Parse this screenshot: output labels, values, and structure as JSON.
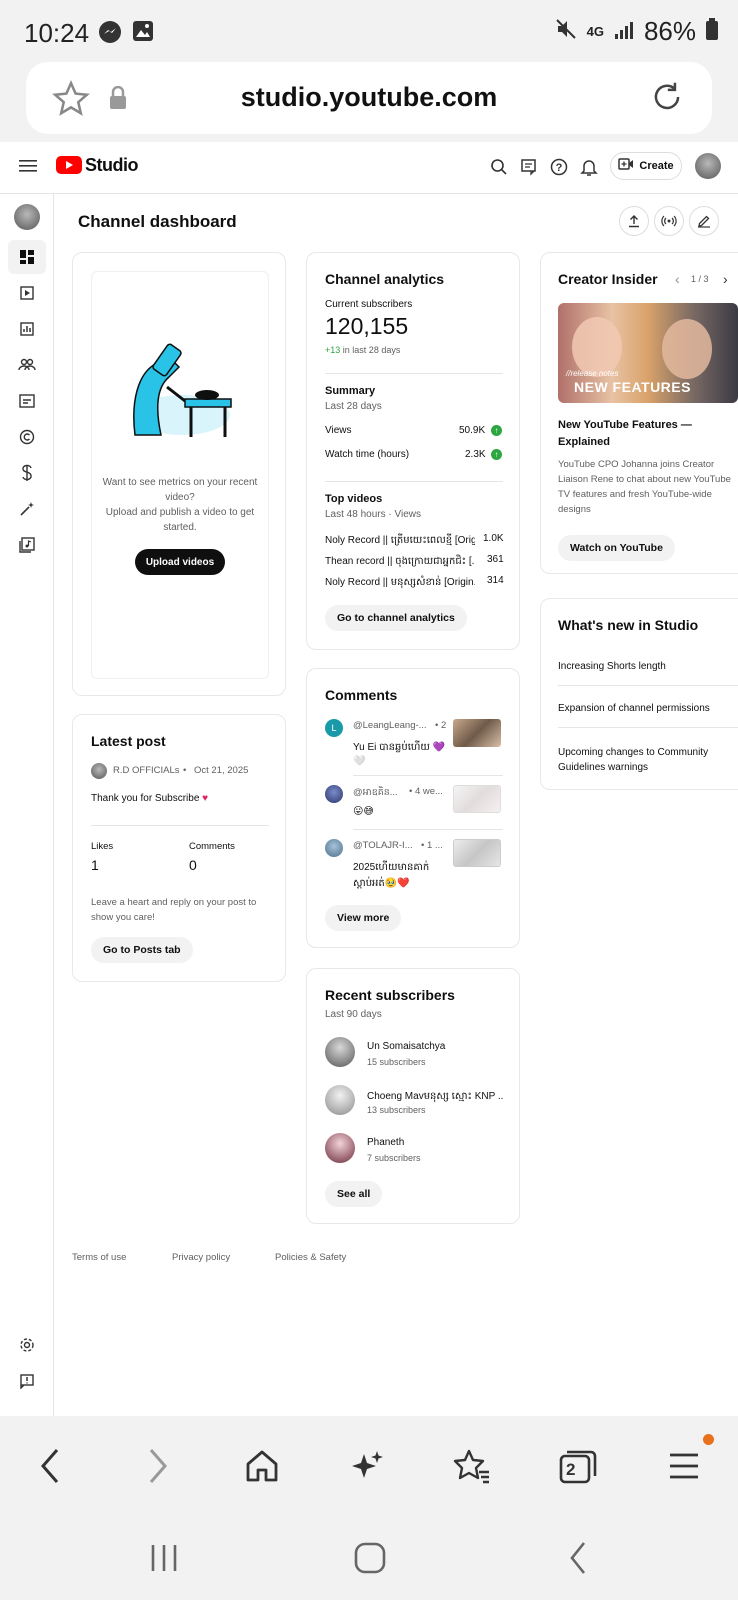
{
  "status": {
    "time": "10:24",
    "network": "4G",
    "battery": "86%"
  },
  "browser": {
    "url": "studio.youtube.com",
    "tab_count": "2"
  },
  "header": {
    "logo": "Studio",
    "create_label": "Create"
  },
  "page": {
    "title": "Channel dashboard"
  },
  "upload_card": {
    "message_1": "Want to see metrics on your recent video?",
    "message_2": "Upload and publish a video to get started.",
    "button": "Upload videos"
  },
  "latest_post": {
    "title": "Latest post",
    "author": "R.D OFFICIALs",
    "date": "Oct 21, 2025",
    "text": "Thank you for Subscribe",
    "likes_label": "Likes",
    "likes_value": "1",
    "comments_label": "Comments",
    "comments_value": "0",
    "hint": "Leave a heart and reply on your post to show you care!",
    "button": "Go to Posts tab"
  },
  "analytics": {
    "title": "Channel analytics",
    "subs_label": "Current subscribers",
    "subs_value": "120,155",
    "subs_change": "+13",
    "subs_change_suffix": "in last 28 days",
    "summary_title": "Summary",
    "summary_period": "Last 28 days",
    "views_label": "Views",
    "views_value": "50.9K",
    "watch_label": "Watch time (hours)",
    "watch_value": "2.3K",
    "top_title": "Top videos",
    "top_period": "Last 48 hours · Views",
    "top_videos": [
      {
        "title": "Noly Record || ត្រើមយេះពេលខ្មី [Origi...",
        "views": "1.0K"
      },
      {
        "title": "Thean record || ចុងក្រោយជាអ្នកជិះ [...",
        "views": "361"
      },
      {
        "title": "Noly Record || មនុស្សសំខាន់ [Origin...",
        "views": "314"
      }
    ],
    "button": "Go to channel analytics"
  },
  "comments": {
    "title": "Comments",
    "items": [
      {
        "author": "@LeangLeang-...",
        "time": "• 2",
        "text": "Yu Ei បានឆ្លប់ហើយ 💜",
        "text2": "🤍",
        "initial": "L"
      },
      {
        "author": "@អាឧគិន...",
        "time": "• 4 we...",
        "text": "😛😅",
        "text2": "",
        "initial": ""
      },
      {
        "author": "@TOLAJR-I...",
        "time": "• 1 ...",
        "text": "2025ហើយមានគាក់",
        "text2": "ស្តាប់អត់🥹❤️",
        "initial": ""
      }
    ],
    "button": "View more"
  },
  "subscribers": {
    "title": "Recent subscribers",
    "period": "Last 90 days",
    "items": [
      {
        "name": "Un Somaisatchya",
        "count": "15 subscribers"
      },
      {
        "name": "Choeng Mavមនុស្ស ស្មោះ KNP ...",
        "count": "13 subscribers"
      },
      {
        "name": "Phaneth",
        "count": "7 subscribers"
      }
    ],
    "button": "See all"
  },
  "creator_insider": {
    "title": "Creator Insider",
    "pager": "1 / 3",
    "thumb_tag": "//release notes",
    "thumb_text": "NEW FEATURES",
    "video_title": "New YouTube Features — Explained",
    "description": "YouTube CPO Johanna joins Creator Liaison Rene to chat about new YouTube TV features and fresh YouTube-wide designs",
    "button": "Watch on YouTube"
  },
  "whats_new": {
    "title": "What's new in Studio",
    "items": [
      "Increasing Shorts length",
      "Expansion of channel permissions",
      "Upcoming changes to Community Guidelines warnings"
    ]
  },
  "footer": {
    "terms": "Terms of use",
    "privacy": "Privacy policy",
    "policies": "Policies & Safety"
  },
  "colors": {
    "brand_red": "#ff0000",
    "accent_green": "#2ba640",
    "bg_grey": "#f2f2f2",
    "notification_orange": "#e8711c"
  }
}
